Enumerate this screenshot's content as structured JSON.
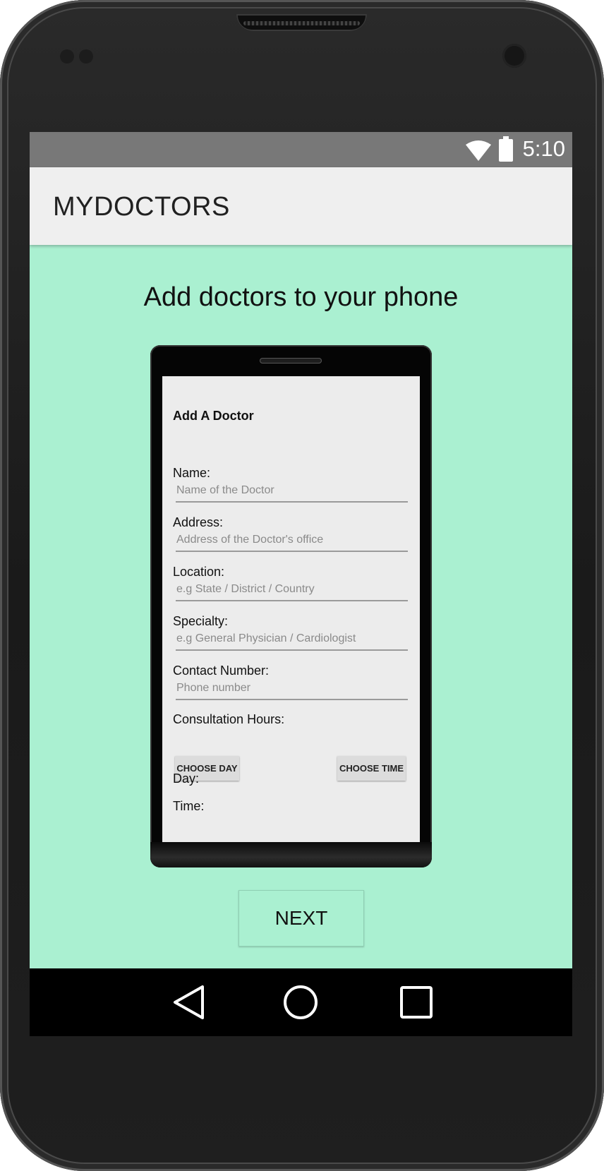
{
  "status_bar": {
    "time": "5:10",
    "wifi_icon": "wifi-icon",
    "battery_icon": "battery-icon"
  },
  "app_bar": {
    "title": "MYDOCTORS"
  },
  "main": {
    "headline": "Add doctors to your phone",
    "next_label": "NEXT"
  },
  "illustration": {
    "form_title": "Add A Doctor",
    "fields": [
      {
        "label": "Name:",
        "placeholder": "Name of the Doctor"
      },
      {
        "label": "Address:",
        "placeholder": "Address of the Doctor's office"
      },
      {
        "label": "Location:",
        "placeholder": "e.g State / District / Country"
      },
      {
        "label": "Specialty:",
        "placeholder": "e.g General Physician / Cardiologist"
      },
      {
        "label": "Contact Number:",
        "placeholder": "Phone number"
      }
    ],
    "consultation_label": "Consultation Hours:",
    "choose_day_label": "CHOOSE DAY",
    "choose_time_label": "CHOOSE TIME",
    "day_label": "Day:",
    "time_label": "Time:"
  },
  "nav_bar": {
    "back_icon": "back-triangle-icon",
    "home_icon": "home-circle-icon",
    "recents_icon": "recents-square-icon"
  },
  "colors": {
    "screen_bg": "#aaf0d1",
    "status_bar": "#787878",
    "app_bar": "#efefef",
    "nav_bar": "#000000"
  }
}
